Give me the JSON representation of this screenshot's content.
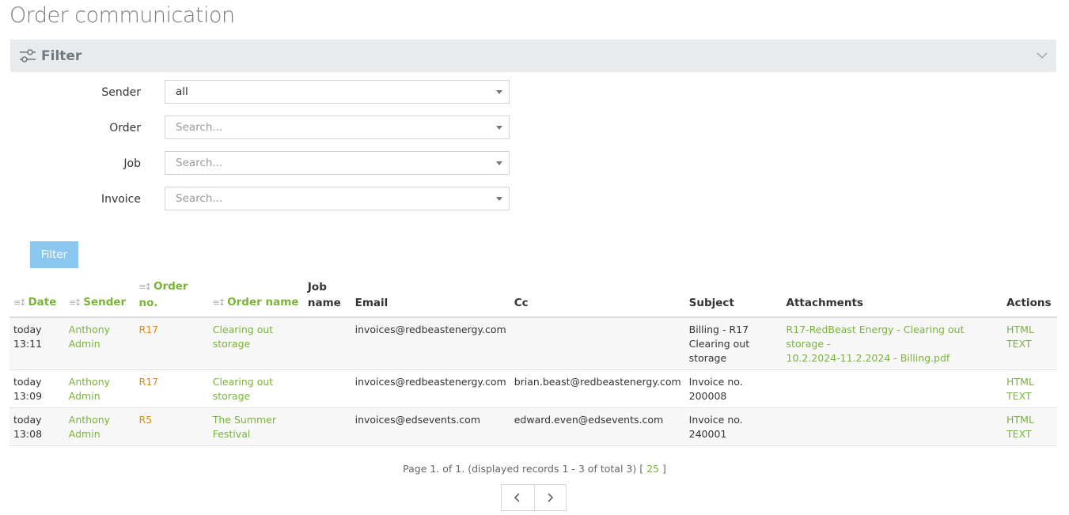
{
  "page": {
    "title": "Order communication"
  },
  "filter": {
    "title": "Filter",
    "fields": [
      {
        "label": "Sender",
        "value": "all",
        "placeholder": ""
      },
      {
        "label": "Order",
        "value": "",
        "placeholder": "Search..."
      },
      {
        "label": "Job",
        "value": "",
        "placeholder": "Search..."
      },
      {
        "label": "Invoice",
        "value": "",
        "placeholder": "Search..."
      }
    ],
    "button_label": "Filter"
  },
  "table": {
    "columns": {
      "date": "Date",
      "sender": "Sender",
      "order_no": "Order no.",
      "order_name": "Order name",
      "job_name_1": "Job",
      "job_name_2": "name",
      "email": "Email",
      "cc": "Cc",
      "subject": "Subject",
      "attachments": "Attachments",
      "actions": "Actions"
    },
    "rows": [
      {
        "date_1": "today",
        "date_2": "13:11",
        "sender_1": "Anthony",
        "sender_2": "Admin",
        "order_no": "R17",
        "order_name_1": "Clearing out",
        "order_name_2": "storage",
        "job_name": "",
        "email": "invoices@redbeastenergy.com",
        "cc": "",
        "subject_1": "Billing - R17",
        "subject_2": "Clearing out",
        "subject_3": "storage",
        "attachment_1": "R17-RedBeast Energy - Clearing out storage -",
        "attachment_2": "10.2.2024-11.2.2024 - Billing.pdf",
        "action_html": "HTML",
        "action_text": "TEXT"
      },
      {
        "date_1": "today",
        "date_2": "13:09",
        "sender_1": "Anthony",
        "sender_2": "Admin",
        "order_no": "R17",
        "order_name_1": "Clearing out",
        "order_name_2": "storage",
        "job_name": "",
        "email": "invoices@redbeastenergy.com",
        "cc": "brian.beast@redbeastenergy.com",
        "subject_1": "Invoice no. 200008",
        "subject_2": "",
        "subject_3": "",
        "attachment_1": "",
        "attachment_2": "",
        "action_html": "HTML",
        "action_text": "TEXT"
      },
      {
        "date_1": "today",
        "date_2": "13:08",
        "sender_1": "Anthony",
        "sender_2": "Admin",
        "order_no": "R5",
        "order_name_1": "The Summer",
        "order_name_2": "Festival",
        "job_name": "",
        "email": "invoices@edsevents.com",
        "cc": "edward.even@edsevents.com",
        "subject_1": "Invoice no. 240001",
        "subject_2": "",
        "subject_3": "",
        "attachment_1": "",
        "attachment_2": "",
        "action_html": "HTML",
        "action_text": "TEXT"
      }
    ]
  },
  "pagination": {
    "summary": "Page 1. of 1. (displayed records 1 - 3 of total 3) [",
    "page_size": "25",
    "summary_end": "]",
    "prev_icon": "chevron-left-icon",
    "next_icon": "chevron-right-icon"
  },
  "colors": {
    "accent": "#7ab33a",
    "order": "#e08a1e",
    "button": "#8cc7f0",
    "filter_bar": "#e8ebee"
  }
}
